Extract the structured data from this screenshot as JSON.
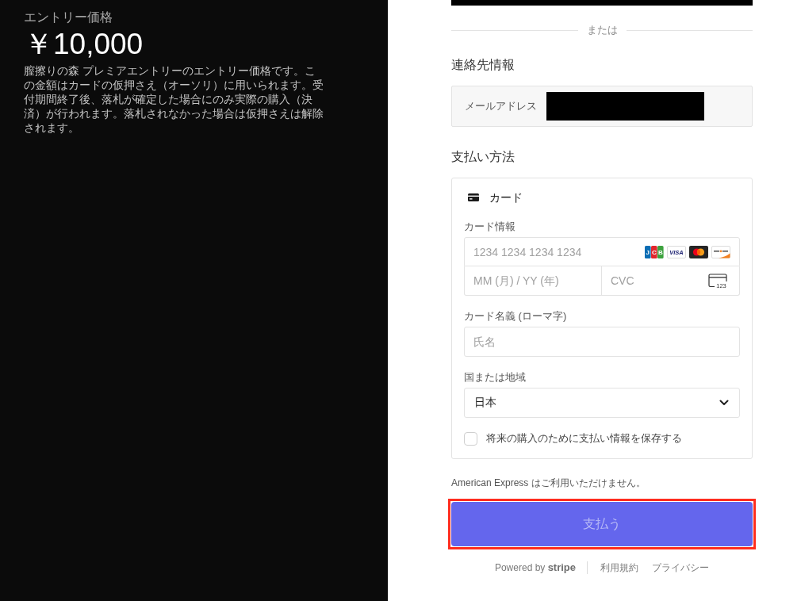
{
  "summary": {
    "label": "エントリー価格",
    "price": "￥10,000",
    "description": "膣擦りの森 プレミアエントリーのエントリー価格です。この金額はカードの仮押さえ（オーソリ）に用いられます。受付期間終了後、落札が確定した場合にのみ実際の購入（決済）が行われます。落札されなかった場合は仮押さえは解除されます。"
  },
  "top_bar": {
    "redacted": true
  },
  "divider": {
    "label": "または"
  },
  "contact": {
    "heading": "連絡先情報",
    "email_label": "メールアドレス",
    "email_redacted": true
  },
  "payment": {
    "heading": "支払い方法",
    "method": {
      "label": "カード"
    },
    "card_info_label": "カード情報",
    "card_number_placeholder": "1234 1234 1234 1234",
    "card_brands": [
      {
        "kind": "jcb",
        "label": "JCB"
      },
      {
        "kind": "visa",
        "label": "VISA"
      },
      {
        "kind": "mastercard"
      },
      {
        "kind": "discover"
      }
    ],
    "expiry_placeholder": "MM (月) / YY (年)",
    "cvc_placeholder": "CVC",
    "cvc_icon_label": "123",
    "name_label": "カード名義 (ローマ字)",
    "name_placeholder": "氏名",
    "country_label": "国または地域",
    "country_value": "日本",
    "save_info": {
      "label": "将来の購入のために支払い情報を保存する",
      "checked": false
    }
  },
  "notice": "American Express はご利用いただけません。",
  "pay_button": {
    "label": "支払う",
    "disabled": true,
    "highlighted": true
  },
  "footer": {
    "powered_by": "Powered by **stripe**",
    "links": [
      "利用規約",
      "プライバシー"
    ]
  }
}
